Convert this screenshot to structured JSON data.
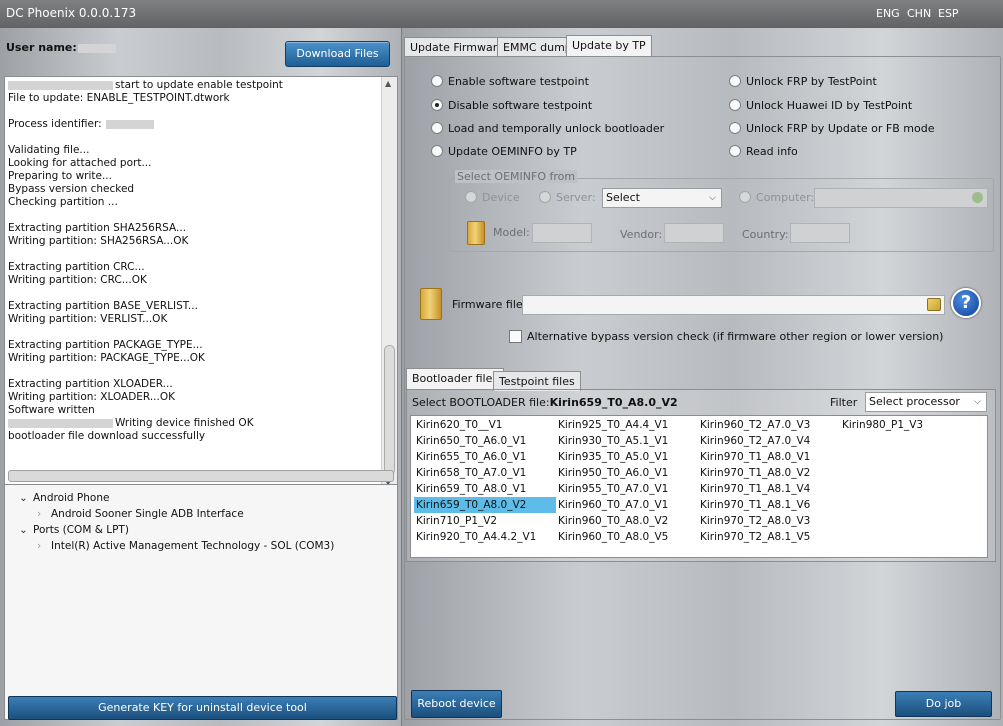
{
  "window": {
    "title": "DC Phoenix 0.0.0.173",
    "languages": [
      "ENG",
      "CHN",
      "ESP"
    ]
  },
  "left": {
    "user_label": "User name:",
    "download_btn": "Download Files",
    "log_lines": [
      {
        "blur": true,
        "text": "start to update enable testpoint"
      },
      {
        "text": "File to update: ENABLE_TESTPOINT.dtwork"
      },
      {
        "text": ""
      },
      {
        "text": "Process identifier:",
        "blur_after": true
      },
      {
        "text": ""
      },
      {
        "text": "Validating file..."
      },
      {
        "text": "Looking for attached port..."
      },
      {
        "text": "Preparing to write..."
      },
      {
        "text": "Bypass version checked"
      },
      {
        "text": "Checking partition ..."
      },
      {
        "text": ""
      },
      {
        "text": "Extracting partition SHA256RSA..."
      },
      {
        "text": "Writing partition: SHA256RSA...OK"
      },
      {
        "text": ""
      },
      {
        "text": "Extracting partition CRC..."
      },
      {
        "text": "Writing partition: CRC...OK"
      },
      {
        "text": ""
      },
      {
        "text": "Extracting partition BASE_VERLIST..."
      },
      {
        "text": "Writing partition: VERLIST...OK"
      },
      {
        "text": ""
      },
      {
        "text": "Extracting partition PACKAGE_TYPE..."
      },
      {
        "text": "Writing partition: PACKAGE_TYPE...OK"
      },
      {
        "text": ""
      },
      {
        "text": "Extracting partition XLOADER..."
      },
      {
        "text": "Writing partition: XLOADER...OK"
      },
      {
        "text": "Software written"
      },
      {
        "blur": true,
        "text": "Writing device finished OK"
      },
      {
        "text": "bootloader file download successfully"
      }
    ],
    "tree": [
      {
        "level": 0,
        "text": "Android Phone",
        "expanded": true
      },
      {
        "level": 1,
        "text": "Android Sooner Single ADB Interface"
      },
      {
        "level": 0,
        "text": "Ports (COM & LPT)",
        "expanded": true
      },
      {
        "level": 1,
        "text": "Intel(R) Active Management Technology - SOL (COM3)"
      }
    ],
    "generate_btn": "Generate KEY for uninstall device tool"
  },
  "right": {
    "tabs": [
      "Update Firmware",
      "EMMC dump",
      "Update by TP"
    ],
    "active_tab": 2,
    "options_left": [
      {
        "label": "Enable software testpoint",
        "checked": false
      },
      {
        "label": "Disable software testpoint",
        "checked": true
      },
      {
        "label": "Load and temporally unlock bootloader",
        "checked": false
      },
      {
        "label": "Update OEMINFO by TP",
        "checked": false
      }
    ],
    "options_right": [
      {
        "label": "Unlock FRP by TestPoint",
        "checked": false
      },
      {
        "label": "Unlock Huawei ID by TestPoint",
        "checked": false
      },
      {
        "label": "Unlock FRP by Update or FB mode",
        "checked": false
      },
      {
        "label": "Read info",
        "checked": false
      }
    ],
    "oeminfo": {
      "title": "Select OEMINFO from",
      "device": "Device",
      "server": "Server:",
      "select_value": "Select",
      "computer": "Computer:",
      "model": "Model:",
      "vendor": "Vendor:",
      "country": "Country:"
    },
    "firmware_label": "Firmware file:",
    "firmware_value": "",
    "alt_bypass": "Alternative bypass version check (if firmware other region or lower version)",
    "file_tabs": [
      "Bootloader files",
      "Testpoint files"
    ],
    "select_label": "Select BOOTLOADER file:",
    "selected_file": "Kirin659_T0_A8.0_V2",
    "filter_label": "Filter",
    "filter_value": "Select processor",
    "files": [
      [
        "Kirin620_T0__V1",
        "Kirin650_T0_A6.0_V1",
        "Kirin655_T0_A6.0_V1",
        "Kirin658_T0_A7.0_V1",
        "Kirin659_T0_A8.0_V1",
        "Kirin659_T0_A8.0_V2",
        "Kirin710_P1_V2",
        "Kirin920_T0_A4.4.2_V1"
      ],
      [
        "Kirin925_T0_A4.4_V1",
        "Kirin930_T0_A5.1_V1",
        "Kirin935_T0_A5.0_V1",
        "Kirin950_T0_A6.0_V1",
        "Kirin955_T0_A7.0_V1",
        "Kirin960_T0_A7.0_V1",
        "Kirin960_T0_A8.0_V2",
        "Kirin960_T0_A8.0_V5"
      ],
      [
        "Kirin960_T2_A7.0_V3",
        "Kirin960_T2_A7.0_V4",
        "Kirin970_T1_A8.0_V1",
        "Kirin970_T1_A8.0_V2",
        "Kirin970_T1_A8.1_V4",
        "Kirin970_T1_A8.1_V6",
        "Kirin970_T2_A8.0_V3",
        "Kirin970_T2_A8.1_V5"
      ],
      [
        "Kirin980_P1_V3"
      ]
    ],
    "reboot_btn": "Reboot device",
    "dojob_btn": "Do job"
  }
}
